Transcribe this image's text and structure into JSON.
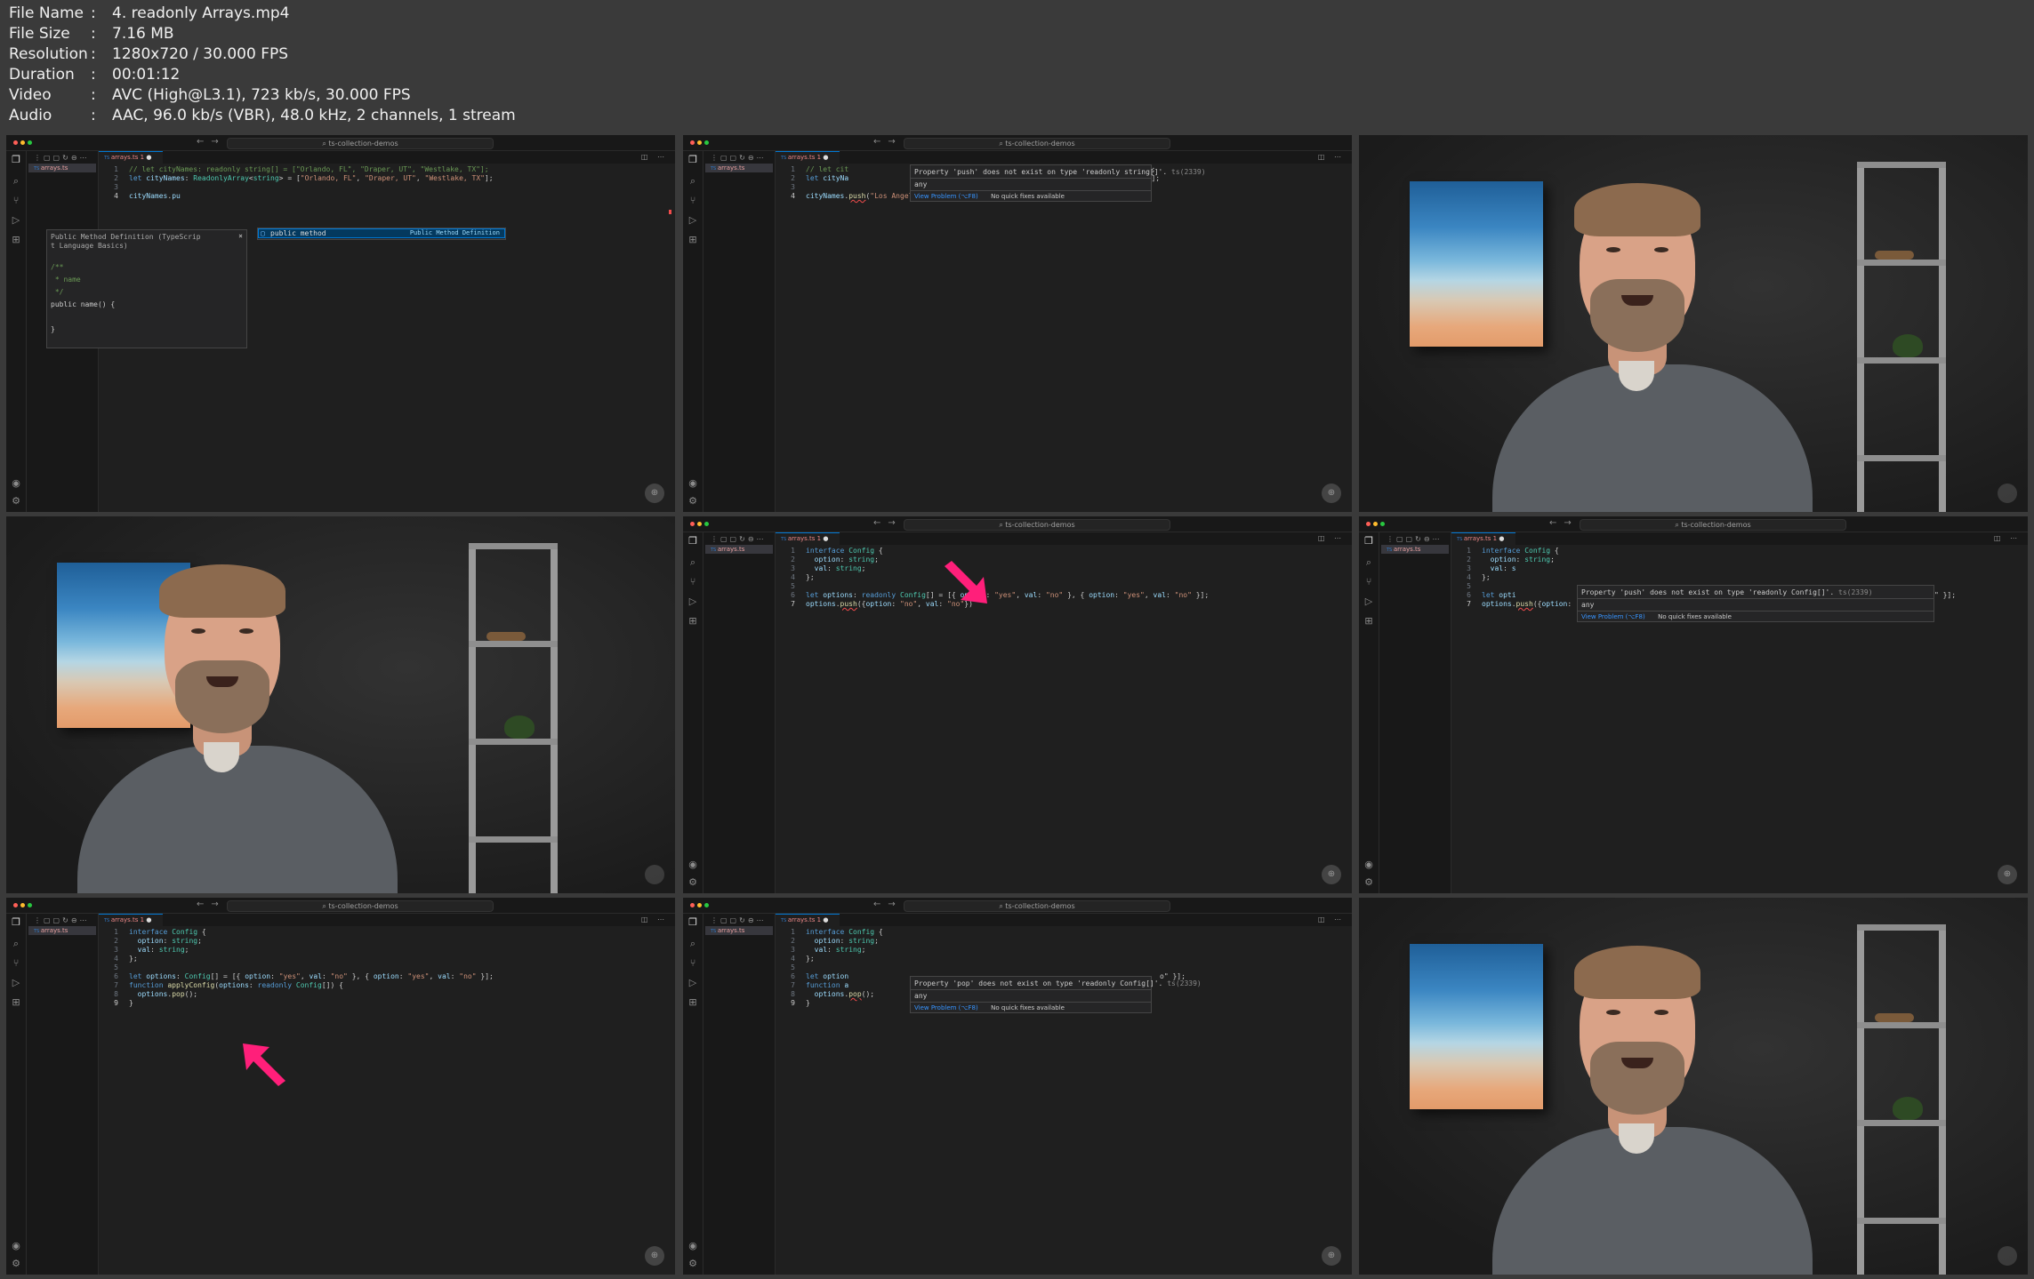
{
  "meta": {
    "rows": [
      {
        "key": "File Name",
        "value": "4. readonly Arrays.mp4"
      },
      {
        "key": "File Size",
        "value": "7.16 MB"
      },
      {
        "key": "Resolution",
        "value": "1280x720 / 30.000 FPS"
      },
      {
        "key": "Duration",
        "value": "00:01:12"
      },
      {
        "key": "Video",
        "value": "AVC (High@L3.1), 723 kb/s, 30.000 FPS"
      },
      {
        "key": "Audio",
        "value": "AAC, 96.0 kb/s (VBR), 48.0 kHz, 2 channels, 1 stream"
      }
    ],
    "separator": ":"
  },
  "editor": {
    "workspace": "ts-collection-demos",
    "file_tab": "arrays.ts 1",
    "file_explorer": "arrays.ts"
  },
  "frames": {
    "f1": {
      "lines": [
        "// let cityNames: readonly string[] = [\"Orlando, FL\", \"Draper, UT\", \"Westlake, TX\"];",
        "let cityNames: ReadonlyArray<string> = [\"Orlando, FL\", \"Draper, UT\", \"Westlake, TX\"];",
        "",
        "cityNames.pu"
      ],
      "suggest_item": "public method",
      "suggest_detail": "Public Method Definition",
      "docs_title": "Public Method Definition (TypeScrip",
      "docs_title2": "t Language Basics)",
      "docs_close": "×",
      "docs_lines": [
        "/**",
        " * name",
        " */",
        "public name() {",
        "",
        "}"
      ]
    },
    "f2": {
      "lines": [
        "// let cit",
        "let cityNa",
        "",
        "cityNames.push(\"Los Angeles, CA\");"
      ],
      "line_tails": [
        "X\"];",
        "TX\"];"
      ],
      "hover_msg": "Property 'push' does not exist on type 'readonly string[]'.",
      "hover_code": "ts(2339)",
      "hover_type": "any",
      "view_problem": "View Problem (⌥F8)",
      "no_fixes": "No quick fixes available"
    },
    "f5": {
      "lines": [
        "interface Config {",
        "  option: string;",
        "  val: string;",
        "};",
        "",
        "let options: readonly Config[] = [{ option: \"yes\", val: \"no\" }, { option: \"yes\", val: \"no\" }];",
        "options.push({option: \"no\", val: \"no\"})"
      ]
    },
    "f6": {
      "lines": [
        "interface Config {",
        "  option: string;",
        "  val: s",
        "};",
        "",
        "let opti",
        "options.push({option: \"no\", val: \"no\"})"
      ],
      "line6_tail": "\", val: \"no\" }];",
      "hover_msg": "Property 'push' does not exist on type 'readonly Config[]'.",
      "hover_code": "ts(2339)",
      "hover_type": "any",
      "view_problem": "View Problem (⌥F8)",
      "no_fixes": "No quick fixes available"
    },
    "f7": {
      "lines": [
        "interface Config {",
        "  option: string;",
        "  val: string;",
        "};",
        "",
        "let options: Config[] = [{ option: \"yes\", val: \"no\" }, { option: \"yes\", val: \"no\" }];",
        "function applyConfig(options: readonly Config[]) {",
        "  options.pop();",
        "}"
      ]
    },
    "f8": {
      "lines": [
        "interface Config {",
        "  option: string;",
        "  val: string;",
        "};",
        "",
        "let option",
        "function a",
        "  options.pop();",
        "}"
      ],
      "line6_tail": "o\" }];",
      "hover_msg": "Property 'pop' does not exist on type 'readonly Config[]'.",
      "hover_code": "ts(2339)",
      "hover_type": "any",
      "view_problem": "View Problem (⌥F8)",
      "no_fixes": "No quick fixes available"
    }
  },
  "line_numbers": [
    "1",
    "2",
    "3",
    "4",
    "5",
    "6",
    "7",
    "8",
    "9"
  ],
  "colors": {
    "annotation_arrow": "#ff1f7a",
    "keyword": "#569cd6",
    "type": "#4ec9b0",
    "string": "#ce9178",
    "error": "#f14c4c"
  }
}
